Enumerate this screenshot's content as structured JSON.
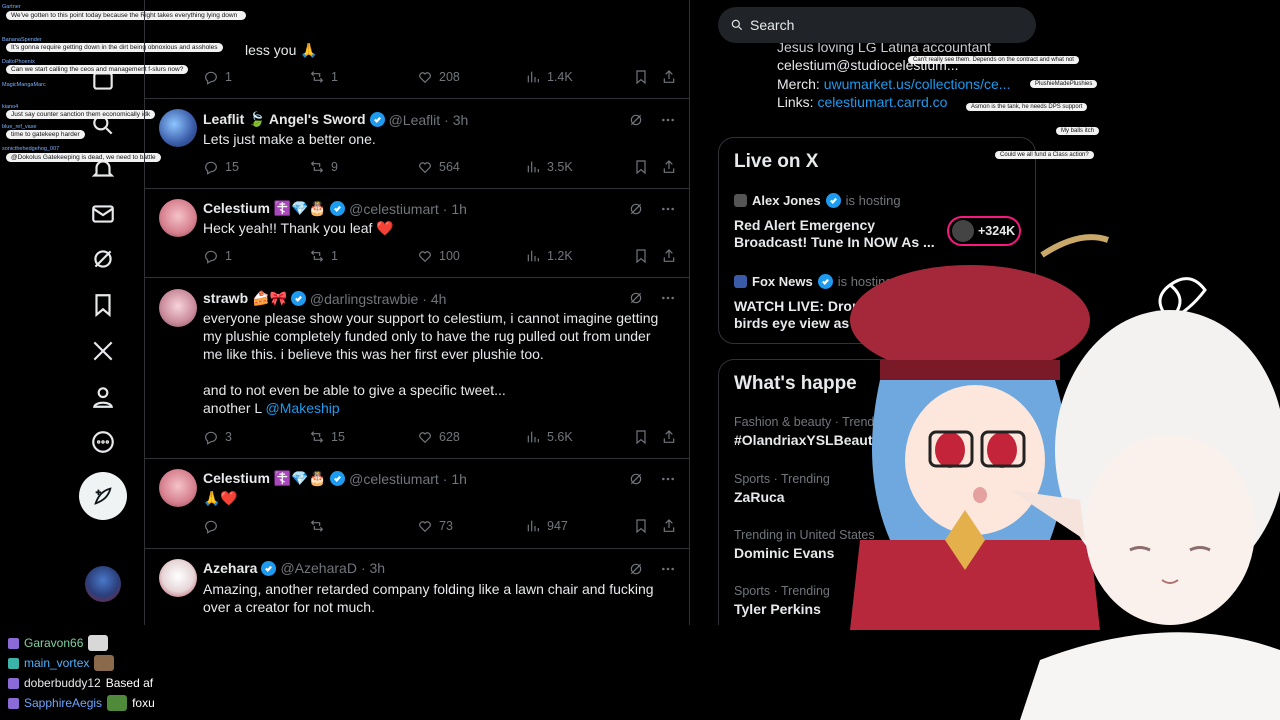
{
  "overlay_chat": {
    "names": [
      "Gartner",
      "BananaSpender",
      "DaltoPhoenix",
      "MagicMangaMarc",
      "kiano4",
      "blue_ref_vase",
      "sonicthehedgehog_007"
    ],
    "messages": [
      "We've gotten to this point today because the Right takes everything lying down",
      "It's gonna require getting down in the dirt being obnoxious and assholes",
      "Can we start calling the ceos and management f-slurs now?",
      "Just say counter sanction them economically idk",
      "time to gatekeep harder",
      "@Dokolus Gatekeeping is dead, we need to battle"
    ]
  },
  "top_fragment": {
    "text": "less you 🙏",
    "replies": "1",
    "reposts": "1",
    "likes": "208",
    "views": "1.4K"
  },
  "tweets": [
    {
      "name": "Leaflit 🍃 Angel's Sword",
      "handle": "@Leaflit",
      "time": "· 3h",
      "text": "Lets just make a better one.",
      "replies": "15",
      "reposts": "9",
      "likes": "564",
      "views": "3.5K"
    },
    {
      "name": "Celestium ☦️💎🎂",
      "handle": "@celestiumart",
      "time": "· 1h",
      "text": "Heck yeah!! Thank you leaf ❤️",
      "replies": "1",
      "reposts": "1",
      "likes": "100",
      "views": "1.2K"
    },
    {
      "name": "strawb 🍰🎀",
      "handle": "@darlingstrawbie",
      "time": "· 4h",
      "text": "everyone please show your support to celestium, i cannot imagine getting\nmy plushie completely funded only to have the rug pulled out from under\nme like this. i believe this was her first ever plushie too.\n\nand to not even be able to give a specific tweet...\nanother L ",
      "mention": "@Makeship",
      "replies": "3",
      "reposts": "15",
      "likes": "628",
      "views": "5.6K"
    },
    {
      "name": "Celestium ☦️💎🎂",
      "handle": "@celestiumart",
      "time": "· 1h",
      "text": "🙏❤️",
      "replies": "",
      "reposts": "",
      "likes": "73",
      "views": "947"
    },
    {
      "name": "Azehara",
      "handle": "@AzeharaD",
      "time": "· 3h",
      "text": "Amazing, another retarded company folding like a lawn chair and fucking\nover a creator for not much."
    }
  ],
  "search": {
    "placeholder": "Search"
  },
  "bio": {
    "line1": "Jesus loving LG Latina accountant",
    "line2": "celestium@studiocelestium...",
    "merch_label": "Merch: ",
    "merch_link": "uwumarket.us/collections/ce...",
    "links_label": "Links: ",
    "links_link": "celestiumart.carrd.co"
  },
  "live": {
    "title": "Live on X",
    "items": [
      {
        "host": "Alex Jones",
        "hosting": "is hosting",
        "title": "Red Alert Emergency\nBroadcast! Tune In NOW As ...",
        "listeners": "+324K"
      },
      {
        "host": "Fox News",
        "hosting": "is hosting",
        "title": "WATCH LIVE: Drone give\nbirds eye view as auth"
      }
    ]
  },
  "trends": {
    "title": "What's happe",
    "items": [
      {
        "meta": "Fashion & beauty · Trendi",
        "name": "#OlandriaxYSLBeauty"
      },
      {
        "meta": "Sports · Trending",
        "name": "ZaRuca"
      },
      {
        "meta": "Trending in United States",
        "name": "Dominic Evans"
      },
      {
        "meta": "Sports · Trending",
        "name": "Tyler Perkins"
      }
    ]
  },
  "right_overlay": {
    "messages": [
      "Can't really see them. Depends on the contract and what not",
      "PlushieMadePlushies",
      "Asmon is the tank, he needs DPS support",
      "My balls itch",
      "Could we all fund a Class action?"
    ]
  },
  "stream_chat": [
    {
      "name": "Garavon66",
      "msg": "",
      "color": "#7fd0a0"
    },
    {
      "name": "main_vortex",
      "msg": "",
      "color": "#4fb3ff"
    },
    {
      "name": "doberbuddy12",
      "msg": "Based af",
      "color": "#e7e9ea"
    },
    {
      "name": "SapphireAegis",
      "msg": "foxu",
      "color": "#6aa8ff"
    }
  ],
  "colors": {
    "accent": "#1d9bf0",
    "live_ring": "#f91880",
    "bg": "#000000",
    "border": "#2f3336"
  }
}
